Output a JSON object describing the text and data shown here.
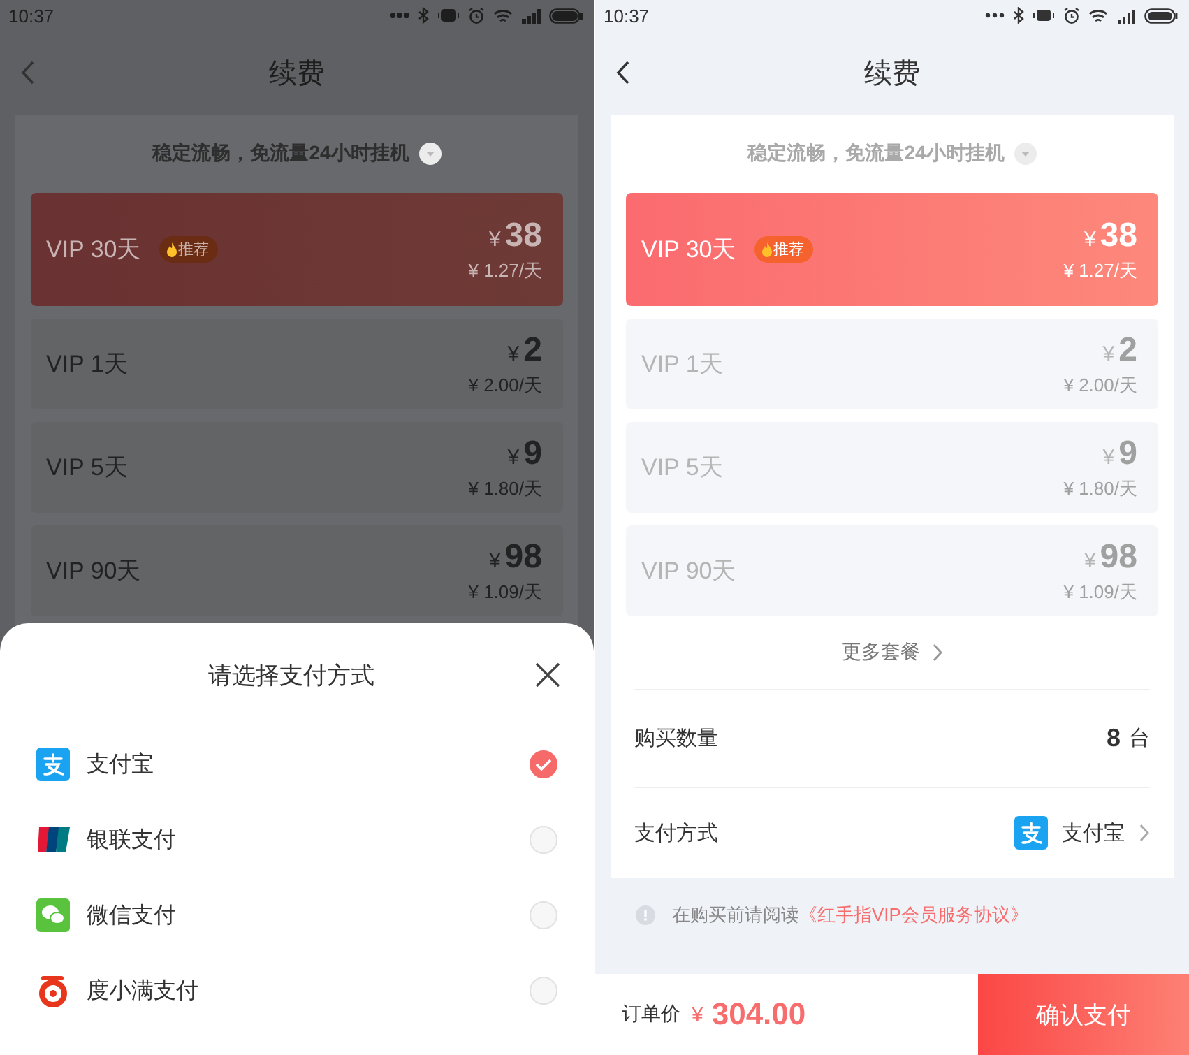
{
  "left_screen": {
    "status_bar": {
      "time": "10:37"
    },
    "nav": {
      "title": "续费"
    },
    "tagline": "稳定流畅，免流量24小时挂机",
    "plans": [
      {
        "name": "VIP 30天",
        "badge": "推荐",
        "currency": "¥",
        "price": "38",
        "per_day": "¥ 1.27/天",
        "selected": true
      },
      {
        "name": "VIP 1天",
        "currency": "¥",
        "price": "2",
        "per_day": "¥ 2.00/天",
        "selected": false
      },
      {
        "name": "VIP 5天",
        "currency": "¥",
        "price": "9",
        "per_day": "¥ 1.80/天",
        "selected": false
      },
      {
        "name": "VIP 90天",
        "currency": "¥",
        "price": "98",
        "per_day": "¥ 1.09/天",
        "selected": false
      }
    ],
    "payment_sheet": {
      "title": "请选择支付方式",
      "options": [
        {
          "kind": "alipay",
          "label": "支付宝",
          "selected": true
        },
        {
          "kind": "unionpay",
          "label": "银联支付",
          "selected": false
        },
        {
          "kind": "wechat",
          "label": "微信支付",
          "selected": false
        },
        {
          "kind": "duxiaoman",
          "label": "度小满支付",
          "selected": false
        }
      ]
    }
  },
  "right_screen": {
    "status_bar": {
      "time": "10:37"
    },
    "nav": {
      "title": "续费"
    },
    "tagline": "稳定流畅，免流量24小时挂机",
    "plans": [
      {
        "name": "VIP 30天",
        "badge": "推荐",
        "currency": "¥",
        "price": "38",
        "per_day": "¥ 1.27/天",
        "selected": true
      },
      {
        "name": "VIP 1天",
        "currency": "¥",
        "price": "2",
        "per_day": "¥ 2.00/天",
        "selected": false
      },
      {
        "name": "VIP 5天",
        "currency": "¥",
        "price": "9",
        "per_day": "¥ 1.80/天",
        "selected": false
      },
      {
        "name": "VIP 90天",
        "currency": "¥",
        "price": "98",
        "per_day": "¥ 1.09/天",
        "selected": false
      }
    ],
    "more_packages": "更多套餐",
    "quantity": {
      "label": "购买数量",
      "value": "8",
      "unit": "台"
    },
    "payment_method": {
      "label": "支付方式",
      "kind": "alipay",
      "value": "支付宝"
    },
    "agreement": {
      "text": "在购买前请阅读",
      "link": "《红手指VIP会员服务协议》"
    },
    "footer": {
      "label": "订单价",
      "currency": "¥",
      "amount": "304.00",
      "button": "确认支付"
    }
  }
}
